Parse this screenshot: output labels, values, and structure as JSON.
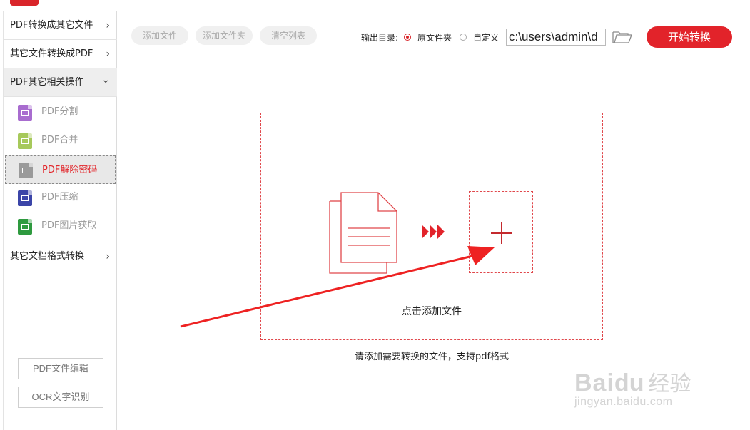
{
  "sidebar": {
    "categories": [
      {
        "label": "PDF转换成其它文件",
        "chevron": "›"
      },
      {
        "label": "其它文件转换成PDF",
        "chevron": "›"
      },
      {
        "label": "PDF其它相关操作",
        "chevron": "⌄"
      },
      {
        "label": "其它文档格式转换",
        "chevron": "›"
      }
    ],
    "items": [
      {
        "label": "PDF分割",
        "icon": "split-icon",
        "color": "#a86ccf"
      },
      {
        "label": "PDF合并",
        "icon": "merge-icon",
        "color": "#a7c95b"
      },
      {
        "label": "PDF解除密码",
        "icon": "lock-icon",
        "color": "#9a9a9a"
      },
      {
        "label": "PDF压缩",
        "icon": "compress-icon",
        "color": "#3b45a8"
      },
      {
        "label": "PDF图片获取",
        "icon": "image-icon",
        "color": "#2e9a3f"
      }
    ],
    "buttons": {
      "edit": "PDF文件编辑",
      "ocr": "OCR文字识别"
    }
  },
  "toolbar": {
    "add_file": "添加文件",
    "add_folder": "添加文件夹",
    "clear_list": "清空列表",
    "output_label": "输出目录:",
    "opt_original": "原文件夹",
    "opt_custom": "自定义",
    "path": "c:\\users\\admin\\d",
    "start": "开始转换"
  },
  "main": {
    "drop_text": "点击添加文件",
    "hint": "请添加需要转换的文件，支持pdf格式"
  },
  "watermark": {
    "brand": "Bai",
    "brand2": "du",
    "cn": "经验",
    "url": "jingyan.baidu.com"
  },
  "colors": {
    "accent": "#e2232a",
    "dash": "#e0474b"
  }
}
